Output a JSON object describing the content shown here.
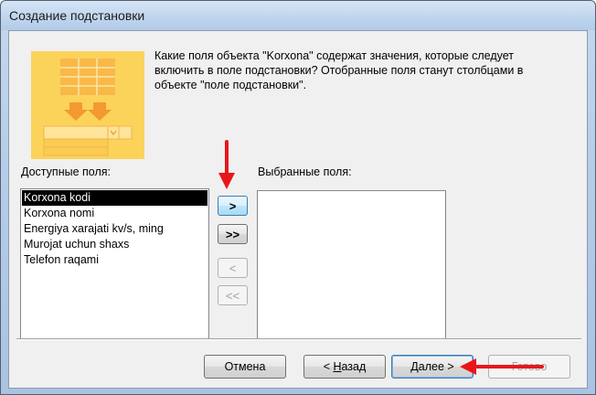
{
  "window": {
    "title": "Создание подстановки"
  },
  "description": "Какие поля объекта \"Korxona\" содержат значения, которые следует включить в поле подстановки? Отобранные поля станут столбцами в объекте \"поле подстановки\".",
  "available": {
    "label": "Доступные поля:",
    "items": [
      {
        "label": "Korxona kodi",
        "selected": true
      },
      {
        "label": "Korxona nomi"
      },
      {
        "label": "Energiya xarajati kv/s, ming"
      },
      {
        "label": "Murojat uchun shaxs"
      },
      {
        "label": "Telefon raqami"
      }
    ]
  },
  "selected": {
    "label": "Выбранные поля:",
    "items": []
  },
  "move_buttons": {
    "add_one": ">",
    "add_all": ">>",
    "remove_one": "<",
    "remove_all": "<<"
  },
  "footer": {
    "cancel": "Отмена",
    "back_prefix": "< ",
    "back_underlined": "Н",
    "back_rest": "азад",
    "next_underlined": "Д",
    "next_rest": "алее >",
    "finish": "Готово"
  },
  "colors": {
    "illustration_yellow": "#f8c94a",
    "illustration_orange": "#f0a030",
    "annotation_arrow": "#e8161b"
  }
}
